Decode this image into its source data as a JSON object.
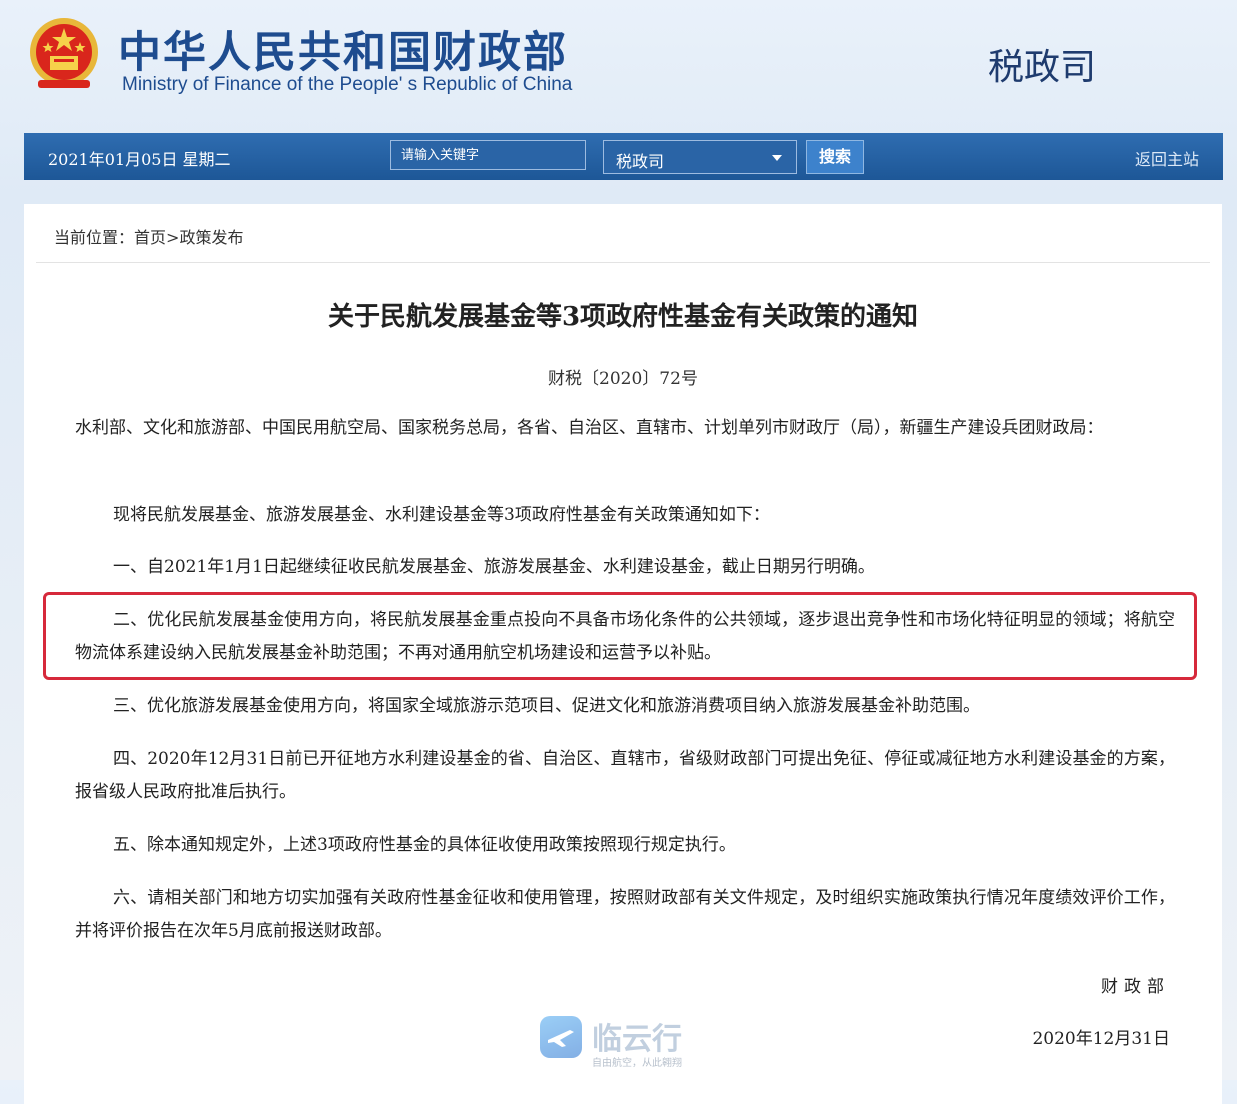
{
  "header": {
    "title_cn": "中华人民共和国财政部",
    "title_en": "Ministry of Finance of the People' s Republic of China",
    "department": "税政司"
  },
  "navbar": {
    "date": "2021年01月05日  星期二",
    "search_placeholder": "请输入关键字",
    "search_value": "",
    "select_value": "税政司",
    "search_button": "搜索",
    "home_link": "返回主站"
  },
  "breadcrumb": {
    "prefix": "当前位置：",
    "home": "首页",
    "separator": ">",
    "current": "政策发布"
  },
  "document": {
    "title": "关于民航发展基金等3项政府性基金有关政策的通知",
    "number": "财税〔2020〕72号",
    "recipients": "水利部、文化和旅游部、中国民用航空局、国家税务总局，各省、自治区、直辖市、计划单列市财政厅（局），新疆生产建设兵团财政局：",
    "intro": "现将民航发展基金、旅游发展基金、水利建设基金等3项政府性基金有关政策通知如下：",
    "items": [
      "一、自2021年1月1日起继续征收民航发展基金、旅游发展基金、水利建设基金，截止日期另行明确。",
      "二、优化民航发展基金使用方向，将民航发展基金重点投向不具备市场化条件的公共领域，逐步退出竞争性和市场化特征明显的领域；将航空物流体系建设纳入民航发展基金补助范围；不再对通用航空机场建设和运营予以补贴。",
      "三、优化旅游发展基金使用方向，将国家全域旅游示范项目、促进文化和旅游消费项目纳入旅游发展基金补助范围。",
      "四、2020年12月31日前已开征地方水利建设基金的省、自治区、直辖市，省级财政部门可提出免征、停征或减征地方水利建设基金的方案，报省级人民政府批准后执行。",
      "五、除本通知规定外，上述3项政府性基金的具体征收使用政策按照现行规定执行。",
      "六、请相关部门和地方切实加强有关政府性基金征收和使用管理，按照财政部有关文件规定，及时组织实施政策执行情况年度绩效评价工作，并将评价报告在次年5月底前报送财政部。"
    ],
    "signature": "财政部",
    "date": "2020年12月31日"
  },
  "watermark": {
    "text": "临云行",
    "subtext": "自由航空，从此翱翔"
  },
  "colors": {
    "brand": "#1e4c8f",
    "nav_bg": "#2566a8",
    "highlight_border": "#d6293b"
  }
}
